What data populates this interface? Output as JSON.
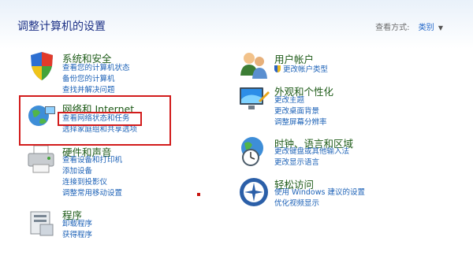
{
  "header": {
    "title": "调整计算机的设置",
    "view_label": "查看方式:",
    "view_value": "类别"
  },
  "left": [
    {
      "title": "系统和安全",
      "links": [
        "查看您的计算机状态",
        "备份您的计算机",
        "查找并解决问题"
      ]
    },
    {
      "title": "网络和 Internet",
      "links": [
        "查看网络状态和任务",
        "选择家庭组和共享选项"
      ]
    },
    {
      "title": "硬件和声音",
      "links": [
        "查看设备和打印机",
        "添加设备",
        "连接到投影仪",
        "调整常用移动设置"
      ]
    },
    {
      "title": "程序",
      "links": [
        "卸载程序",
        "获得程序"
      ]
    }
  ],
  "right": [
    {
      "title": "用户帐户",
      "links": [
        "更改帐户类型"
      ]
    },
    {
      "title": "外观和个性化",
      "links": [
        "更改主题",
        "更改桌面背景",
        "调整屏幕分辨率"
      ]
    },
    {
      "title": "时钟、语言和区域",
      "links": [
        "更改键盘或其他输入法",
        "更改显示语言"
      ]
    },
    {
      "title": "轻松访问",
      "links": [
        "使用 Windows 建议的设置",
        "优化视频显示"
      ]
    }
  ],
  "colors": {
    "highlight": "#d21c1c",
    "link": "#1d62b7",
    "title": "#1e5b18"
  },
  "icons": [
    "shield-flag-icon",
    "network-globe-icon",
    "printer-icon",
    "programs-icon",
    "users-icon",
    "monitor-icon",
    "clock-globe-icon",
    "ease-of-access-icon",
    "uac-shield-icon",
    "dropdown-caret-icon"
  ]
}
